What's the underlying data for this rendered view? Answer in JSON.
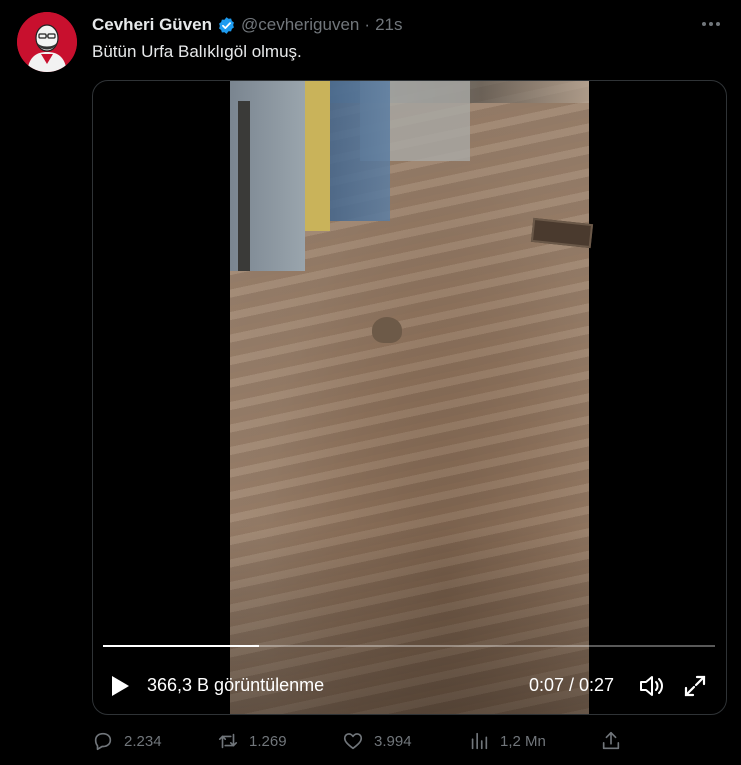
{
  "author": {
    "name": "Cevheri Güven",
    "handle": "@cevheriguven",
    "separator": "·",
    "time": "21s"
  },
  "tweet": {
    "text": "Bütün Urfa Balıklıgöl olmuş."
  },
  "video": {
    "views_label": "366,3 B görüntülenme",
    "timer": "0:07 / 0:27",
    "progress": 0.255
  },
  "actions": {
    "replies": "2.234",
    "retweets": "1.269",
    "likes": "3.994",
    "views": "1,2 Mn"
  },
  "colors": {
    "background": "#000000",
    "text": "#e7e9ea",
    "muted": "#71767b",
    "verified": "#1d9bf0",
    "border": "#2f3336"
  },
  "icons": [
    "verified-badge-icon",
    "more-icon",
    "play-icon",
    "volume-icon",
    "fullscreen-icon",
    "reply-icon",
    "retweet-icon",
    "like-icon",
    "views-icon",
    "share-icon"
  ]
}
